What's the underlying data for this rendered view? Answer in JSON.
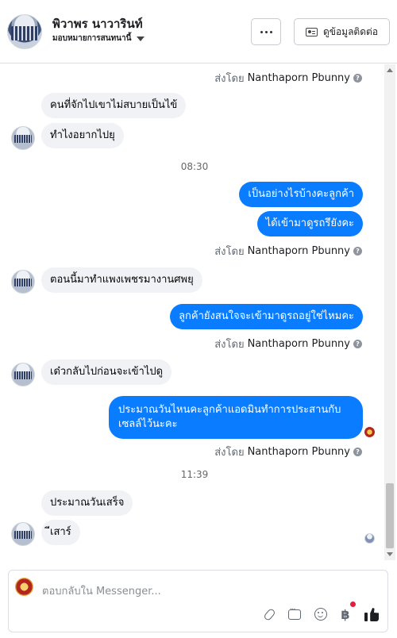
{
  "header": {
    "contact_name": "พิวาพร นาวารินท์",
    "assign_label": "มอบหมายการสนทนานี้",
    "more_label": "···",
    "view_contact_label": "ดูข้อมูลติดต่อ"
  },
  "messages": {
    "m1": "คนที่จักไปเขาไม่สบายเป็นไข้",
    "m2": "ทำไงอยากไปยุ",
    "t1": "08:30",
    "m3": "เป็นอย่างไรบ้างคะลูกค้า",
    "m4": "ได้เข้ามาดูรถรึยังคะ",
    "m5": "ตอนนี้มาทำแพงเพชรมางานศพยุ",
    "m6": "ลูกค้ายังสนใจจะเข้ามาดูรถอยู่ใช่ไหมคะ",
    "m7": "เด๋วกลับไปก่อนจะเข้าไปดู",
    "m8_line1": "ประมาณวันไหนคะลูกค้าแอดมินทำการประสานกับ",
    "m8_line2": "เซลล์ไว้นะคะ",
    "t2": "11:39",
    "m9": "ประมาณวันเสร็จ",
    "m10": "ีเสาร์"
  },
  "sent_by": {
    "prefix": "ส่งโดย",
    "name": "Nanthaporn Pbunny",
    "help_icon": "?"
  },
  "composer": {
    "placeholder": "ตอบกลับใน Messenger...",
    "baht_symbol": "฿"
  },
  "colors": {
    "outgoing": "#0a7cff",
    "incoming": "#f0f2f5",
    "notification_dot": "#e41e3f"
  },
  "icons": [
    "more-dots-icon",
    "id-card-icon",
    "caret-down-icon",
    "help-icon",
    "attach-icon",
    "saved-replies-icon",
    "emoji-icon",
    "payment-icon",
    "like-icon"
  ]
}
